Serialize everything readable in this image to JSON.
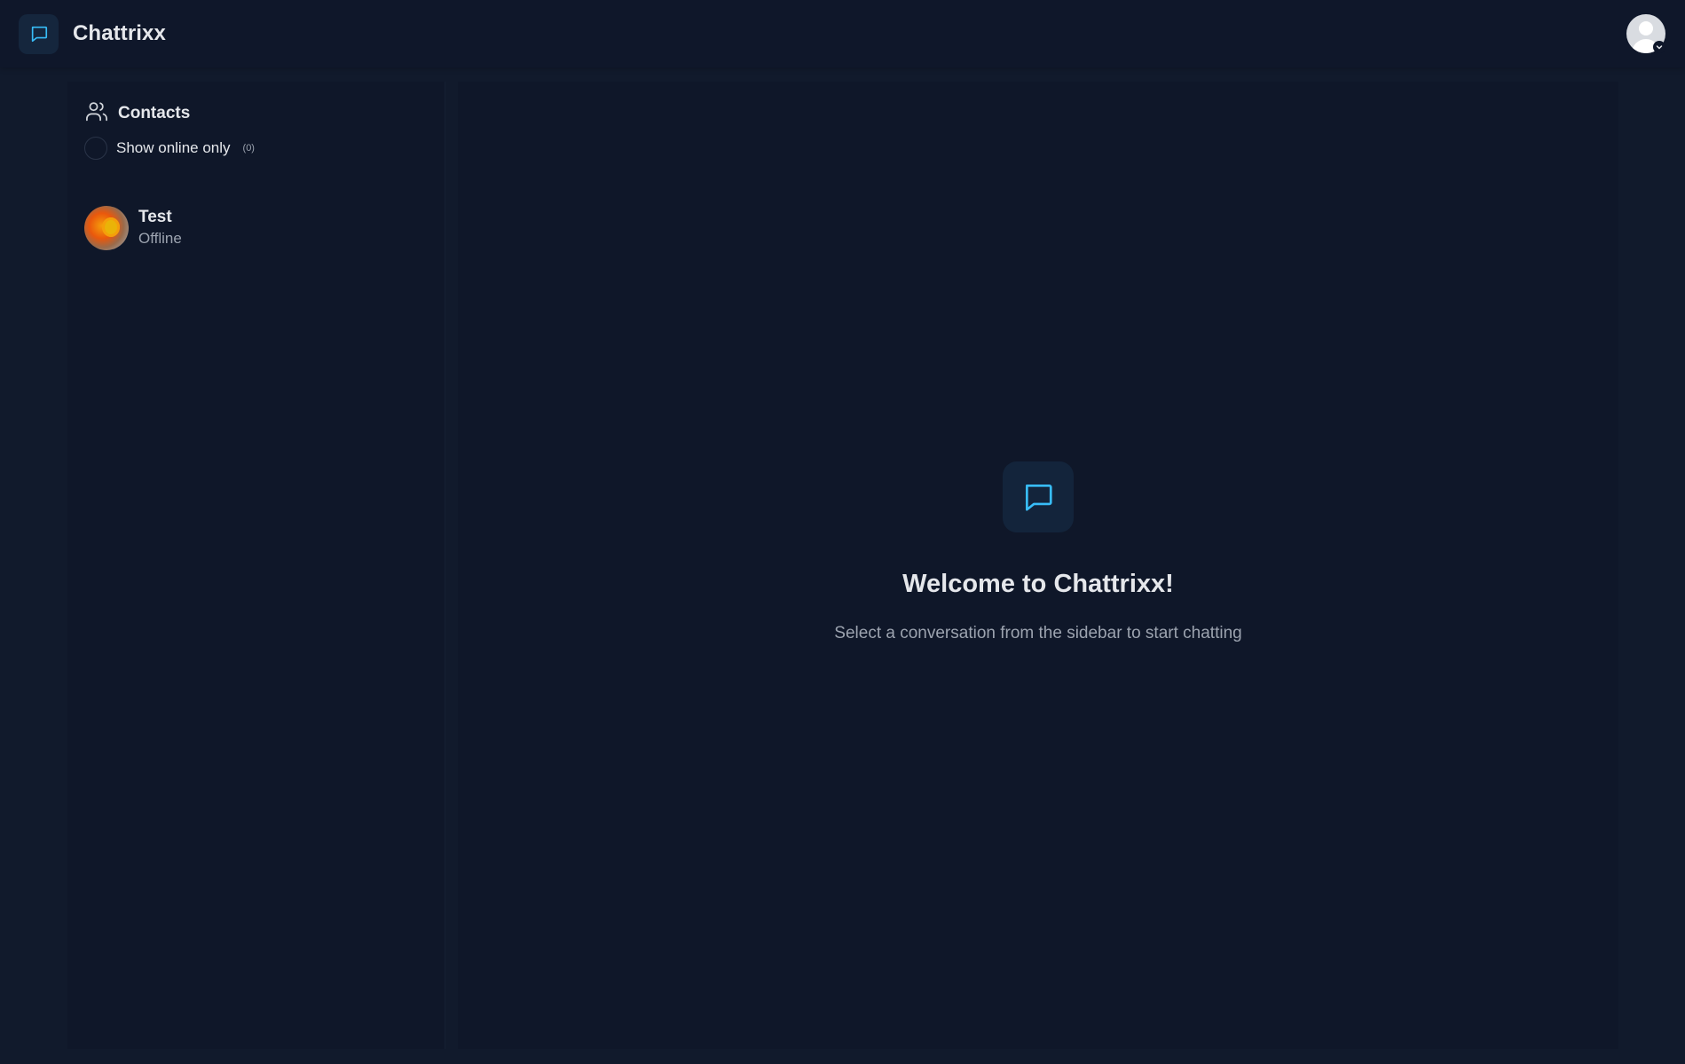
{
  "header": {
    "app_name": "Chattrixx",
    "logo_icon": "chat-bubble-icon",
    "user_menu_icon": "user-avatar-icon"
  },
  "sidebar": {
    "title": "Contacts",
    "title_icon": "users-icon",
    "online_toggle": {
      "label": "Show online only",
      "count": "(0)",
      "checked": false
    },
    "contacts": [
      {
        "name": "Test",
        "status": "Offline"
      }
    ]
  },
  "main": {
    "icon": "chat-bubble-icon",
    "title": "Welcome to Chattrixx!",
    "subtitle": "Select a conversation from the sidebar to start chatting"
  },
  "colors": {
    "background": "#0f1729",
    "accent": "#38bdf8",
    "text": "#e5e7eb",
    "muted": "#9ca3af"
  }
}
